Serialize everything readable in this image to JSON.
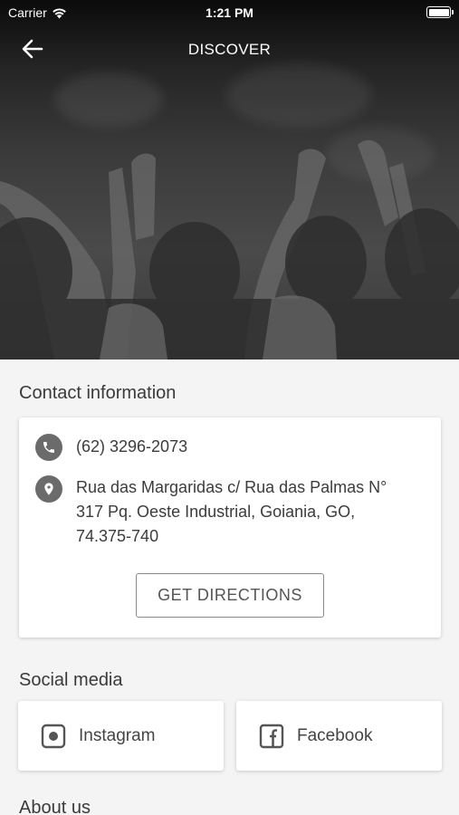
{
  "status_bar": {
    "carrier": "Carrier",
    "time": "1:21 PM"
  },
  "nav": {
    "title": "DISCOVER"
  },
  "contact": {
    "heading": "Contact information",
    "phone": "(62) 3296-2073",
    "address_line1": "Rua das Margaridas c/ Rua das Palmas N°",
    "address_line2": "317 Pq. Oeste Industrial, Goiania, GO,",
    "address_line3": "74.375-740",
    "directions_label": "GET DIRECTIONS"
  },
  "social": {
    "heading": "Social media",
    "items": [
      {
        "label": "Instagram",
        "icon": "instagram-icon"
      },
      {
        "label": "Facebook",
        "icon": "facebook-icon"
      }
    ]
  },
  "about": {
    "heading": "About us"
  },
  "colors": {
    "icon_gray": "#6b6b6b",
    "background": "#f4f4f4",
    "card": "#ffffff"
  }
}
